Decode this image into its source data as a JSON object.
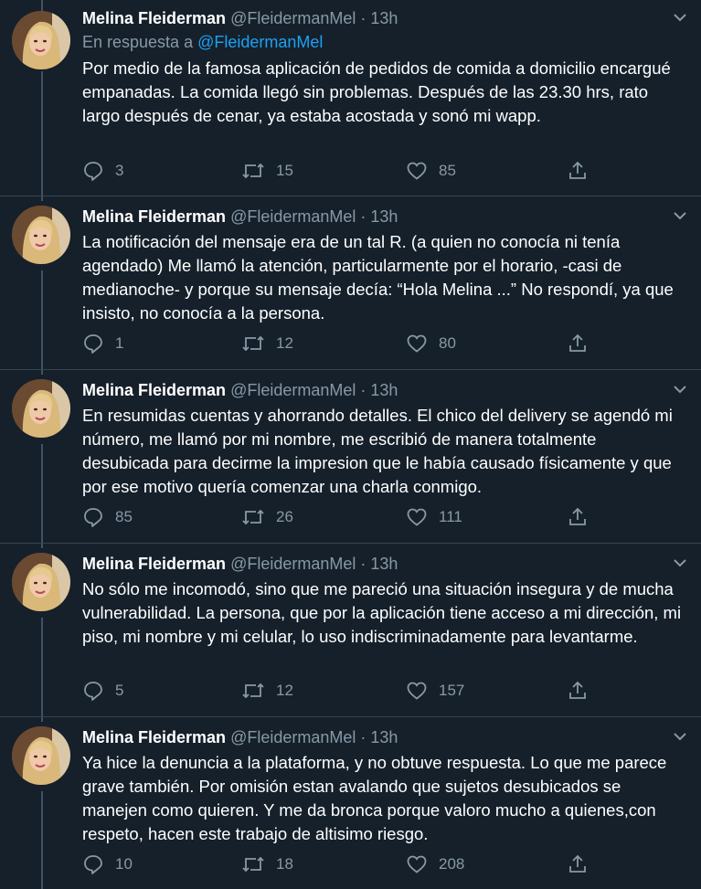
{
  "colors": {
    "background": "#15202b",
    "secondary_text": "#8899a6",
    "link": "#1da1f2"
  },
  "reply_to": {
    "prefix": "En respuesta a",
    "handle": "@FleidermanMel"
  },
  "tweets": [
    {
      "name": "Melina Fleiderman",
      "handle": "@FleidermanMel",
      "dot": "·",
      "time": "13h",
      "text": "Por medio de la famosa aplicación de pedidos de comida a domicilio encargué empanadas. La comida llegó sin problemas. Después de las 23.30 hrs, rato largo después de cenar, ya estaba acostada y sonó mi wapp.",
      "replies": "3",
      "retweets": "15",
      "likes": "85"
    },
    {
      "name": "Melina Fleiderman",
      "handle": "@FleidermanMel",
      "dot": "·",
      "time": "13h",
      "text": "La notificación del mensaje era de un tal R.  (a quien no conocía ni tenía agendado) Me llamó la atención, particularmente por el horario, -casi de medianoche- y porque su mensaje decía: “Hola Melina ...” No respondí, ya que insisto, no conocía a la persona.",
      "replies": "1",
      "retweets": "12",
      "likes": "80"
    },
    {
      "name": "Melina Fleiderman",
      "handle": "@FleidermanMel",
      "dot": "·",
      "time": "13h",
      "text": "En resumidas cuentas y ahorrando detalles. El chico del delivery se agendó mi número, me llamó por mi nombre, me escribió de manera totalmente desubicada para decirme la impresion que le había causado físicamente y que por ese motivo quería comenzar una charla conmigo.",
      "replies": "85",
      "retweets": "26",
      "likes": "111"
    },
    {
      "name": "Melina Fleiderman",
      "handle": "@FleidermanMel",
      "dot": "·",
      "time": "13h",
      "text": "No sólo me incomodó, sino que me pareció una situación insegura y de mucha vulnerabilidad. La persona, que por la aplicación tiene acceso a mi dirección, mi piso, mi nombre y mi celular, lo uso indiscriminadamente para levantarme.",
      "replies": "5",
      "retweets": "12",
      "likes": "157"
    },
    {
      "name": "Melina Fleiderman",
      "handle": "@FleidermanMel",
      "dot": "·",
      "time": "13h",
      "text": "Ya hice la denuncia a la plataforma, y no obtuve respuesta. Lo que me parece grave también. Por omisión estan avalando que sujetos desubicados se manejen como quieren. Y me da bronca porque valoro mucho a quienes,con respeto, hacen este trabajo de altisimo riesgo.",
      "replies": "10",
      "retweets": "18",
      "likes": "208"
    }
  ]
}
